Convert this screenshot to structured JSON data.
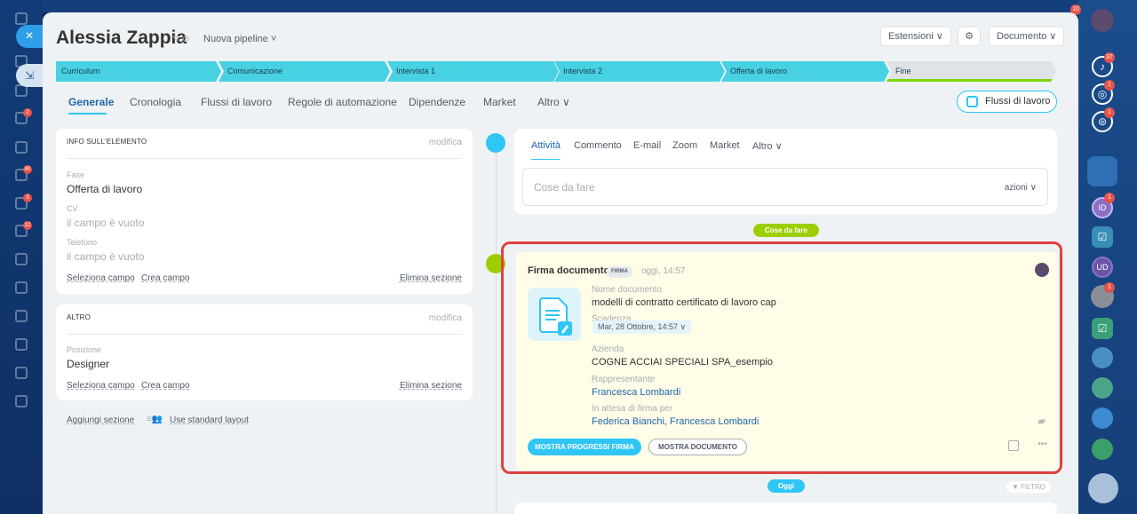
{
  "header": {
    "title": "Alessia Zappia",
    "pipeline": "Nuova pipeline ˅",
    "extensions": "Estensioni ∨",
    "document": "Documento ∨"
  },
  "stages": [
    "Curriculum",
    "Comunicazione",
    "Intervista 1",
    "Intervista 2",
    "Offerta di lavoro",
    "Fine"
  ],
  "tabs": [
    "Generale",
    "Cronologia",
    "Flussi di lavoro",
    "Regole di automazione",
    "Dipendenze",
    "Market",
    "Altro ∨"
  ],
  "flussi_button": "Flussi di lavoro",
  "info_card": {
    "title": "INFO SULL'ELEMENTO",
    "edit": "modifica",
    "fields": [
      {
        "label": "Fase",
        "value": "Offerta di lavoro"
      },
      {
        "label": "CV",
        "value": "il campo è vuoto"
      },
      {
        "label": "Telefono",
        "value": "il campo è vuoto"
      }
    ],
    "select_field": "Seleziona campo",
    "create_field": "Crea campo",
    "delete_section": "Elimina sezione"
  },
  "other_card": {
    "title": "ALTRO",
    "edit": "modifica",
    "position_label": "Posizione",
    "position_value": "Designer",
    "select_field": "Seleziona campo",
    "create_field": "Crea campo",
    "delete_section": "Elimina sezione"
  },
  "add_section": "Aggiungi sezione",
  "standard_layout": "Use standard layout",
  "activity": {
    "tabs": [
      "Attività",
      "Commento",
      "E-mail",
      "Zoom",
      "Market",
      "Altro ∨"
    ],
    "placeholder": "Cose da fare",
    "actions": "azioni ∨"
  },
  "todo_pill": "Cose da fare",
  "today_pill": "Oggi",
  "filter": "▼ FILTRO",
  "doc": {
    "title": "Firma documento",
    "tag": "FIRMA",
    "time": "oggi, 14:57",
    "name_label": "Nome documento",
    "name_value": "modelli di contratto certificato di lavoro cap",
    "deadline_label": "Scadenza",
    "deadline_value": "Mar, 28 Ottobre, 14:57 ∨",
    "company_label": "Azienda",
    "company_value": "COGNE ACCIAI SPECIALI SPA_esempio",
    "rep_label": "Rappresentante",
    "rep_value": "Francesca Lombardi",
    "waiting_label": "In attesa di firma per",
    "waiting_value": "Federica Bianchi, Francesca Lombardi",
    "btn_progress": "MOSTRA PROGRESSI FIRMA",
    "btn_document": "MOSTRA DOCUMENTO",
    "more": "•••"
  },
  "right_badges": [
    "37",
    "1",
    "1",
    "1",
    "1"
  ],
  "left_badges": [
    "2",
    "40",
    "3",
    "12"
  ],
  "top_badge": "10",
  "right_initials": "ID",
  "right_initials_2": "UD",
  "colors": {
    "accent": "#2fc6f6",
    "stage": "#47d1e2",
    "highlight": "#e0413c",
    "doc_bg": "#fffde7"
  }
}
